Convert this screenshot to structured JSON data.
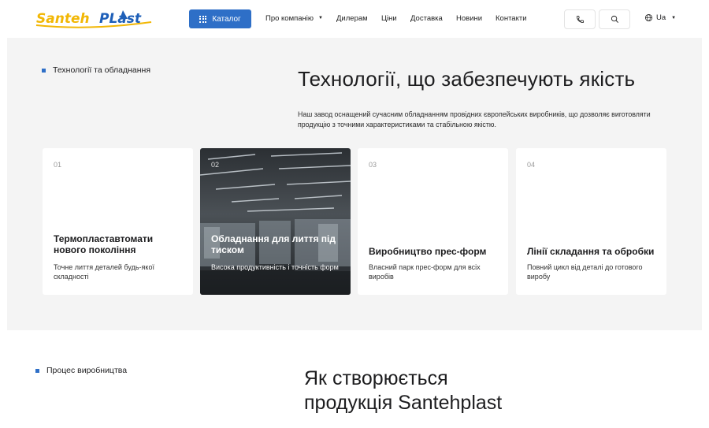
{
  "header": {
    "logo_text": "SantehPlast",
    "catalog_label": "Каталог",
    "nav": [
      {
        "label": "Про компанію",
        "has_dropdown": true
      },
      {
        "label": "Дилерам"
      },
      {
        "label": "Ціни"
      },
      {
        "label": "Доставка"
      },
      {
        "label": "Новини"
      },
      {
        "label": "Контакти"
      }
    ],
    "phone_icon": "phone-icon",
    "search_icon": "search-icon",
    "language": "Ua"
  },
  "tech": {
    "section_label": "Технології та обладнання",
    "title": "Технології, що забезпечують якість",
    "description": "Наш завод оснащений сучасним обладнанням провідних європейських виробників, що дозволяє виготовляти продукцію з точними характеристиками та стабільною якістю.",
    "cards": [
      {
        "num": "01",
        "title": "Термопластавтомати нового покоління",
        "text": "Точне лиття деталей будь-якої складності"
      },
      {
        "num": "02",
        "title": "Обладнання для лиття під тиском",
        "text": "Висока продуктивність і точність форм"
      },
      {
        "num": "03",
        "title": "Виробництво прес-форм",
        "text": "Власний парк прес-форм для всіх виробів"
      },
      {
        "num": "04",
        "title": "Лінії складання та обробки",
        "text": "Повний цикл від деталі до готового виробу"
      }
    ]
  },
  "process": {
    "section_label": "Процес виробництва",
    "title_line1": "Як створюється",
    "title_line2": "продукція Santehplast"
  },
  "colors": {
    "accent": "#2e6fc7",
    "section_bg": "#f4f4f4",
    "logo_yellow": "#f2b705",
    "logo_blue": "#1e5fb8"
  }
}
